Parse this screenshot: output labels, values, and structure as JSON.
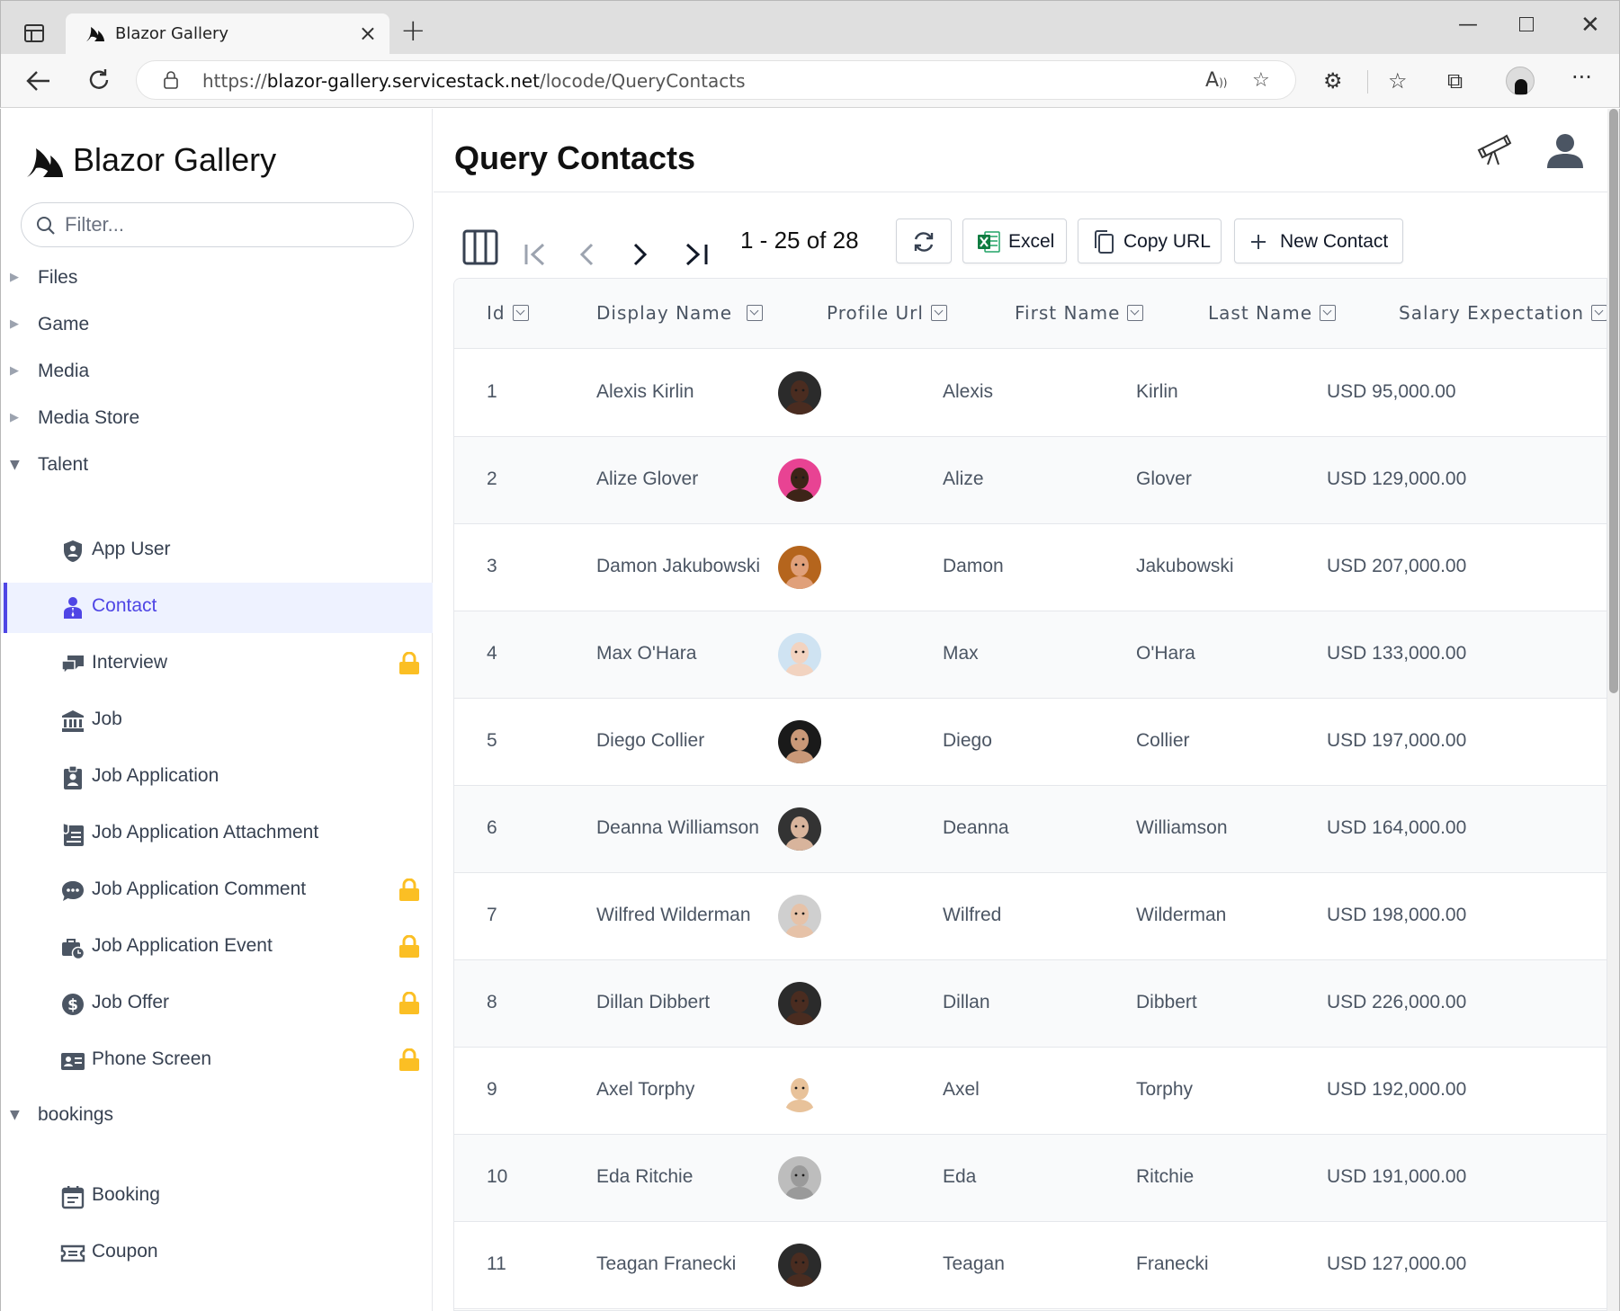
{
  "browser": {
    "tab_title": "Blazor Gallery",
    "url_prefix": "https://",
    "url_host": "blazor-gallery.servicestack.net",
    "url_path": "/locode/QueryContacts",
    "icons": [
      "tab-actions-icon",
      "close-icon",
      "plus-icon",
      "minimize-icon",
      "maximize-icon",
      "close-window-icon",
      "back-icon",
      "refresh-icon",
      "lock-icon",
      "read-aloud-icon",
      "add-favorite-icon",
      "extensions-icon",
      "favorites-icon",
      "collections-icon",
      "profile-icon",
      "more-icon"
    ]
  },
  "sidebar": {
    "brand": "Blazor Gallery",
    "filter_placeholder": "Filter...",
    "groups": [
      {
        "label": "Files",
        "open": false
      },
      {
        "label": "Game",
        "open": false
      },
      {
        "label": "Media",
        "open": false
      },
      {
        "label": "Media Store",
        "open": false
      },
      {
        "label": "Talent",
        "open": true
      },
      {
        "label": "bookings",
        "open": true
      }
    ],
    "talent_items": [
      {
        "label": "App User",
        "icon": "shield-user-icon",
        "locked": false
      },
      {
        "label": "Contact",
        "icon": "contact-icon",
        "locked": false,
        "active": true
      },
      {
        "label": "Interview",
        "icon": "chat-bubbles-icon",
        "locked": true
      },
      {
        "label": "Job",
        "icon": "bank-icon",
        "locked": false
      },
      {
        "label": "Job Application",
        "icon": "id-badge-icon",
        "locked": false
      },
      {
        "label": "Job Application Attachment",
        "icon": "attachment-list-icon",
        "locked": false
      },
      {
        "label": "Job Application Comment",
        "icon": "comment-icon",
        "locked": true
      },
      {
        "label": "Job Application Event",
        "icon": "briefcase-clock-icon",
        "locked": true
      },
      {
        "label": "Job Offer",
        "icon": "dollar-icon",
        "locked": true
      },
      {
        "label": "Phone Screen",
        "icon": "contact-card-icon",
        "locked": true
      }
    ],
    "bookings_items": [
      {
        "label": "Booking",
        "icon": "calendar-icon"
      },
      {
        "label": "Coupon",
        "icon": "ticket-icon"
      }
    ],
    "accent": "#4f46e5",
    "lock_color": "#fbbf24"
  },
  "main": {
    "title": "Query Contacts",
    "paging": "1 - 25 of 28",
    "buttons": {
      "excel": "Excel",
      "copy_url": "Copy URL",
      "new": "New Contact"
    },
    "columns": [
      "Id",
      "Display Name",
      "Profile Url",
      "First Name",
      "Last Name",
      "Salary Expectation"
    ],
    "rows": [
      {
        "id": "1",
        "display": "Alexis Kirlin",
        "first": "Alexis",
        "last": "Kirlin",
        "salary": "USD 95,000.00",
        "skin": "#4a2c20",
        "bg": "#2b2b2b"
      },
      {
        "id": "2",
        "display": "Alize Glover",
        "first": "Alize",
        "last": "Glover",
        "salary": "USD 129,000.00",
        "skin": "#3d2418",
        "bg": "#e84393"
      },
      {
        "id": "3",
        "display": "Damon Jakubowski",
        "first": "Damon",
        "last": "Jakubowski",
        "salary": "USD 207,000.00",
        "skin": "#e0a07a",
        "bg": "#b5651d"
      },
      {
        "id": "4",
        "display": "Max O'Hara",
        "first": "Max",
        "last": "O'Hara",
        "salary": "USD 133,000.00",
        "skin": "#f2d3c0",
        "bg": "#cfe3f2"
      },
      {
        "id": "5",
        "display": "Diego Collier",
        "first": "Diego",
        "last": "Collier",
        "salary": "USD 197,000.00",
        "skin": "#c99878",
        "bg": "#1a1a1a"
      },
      {
        "id": "6",
        "display": "Deanna Williamson",
        "first": "Deanna",
        "last": "Williamson",
        "salary": "USD 164,000.00",
        "skin": "#d8b49c",
        "bg": "#333333"
      },
      {
        "id": "7",
        "display": "Wilfred Wilderman",
        "first": "Wilfred",
        "last": "Wilderman",
        "salary": "USD 198,000.00",
        "skin": "#e6c2a8",
        "bg": "#cfcfcf"
      },
      {
        "id": "8",
        "display": "Dillan Dibbert",
        "first": "Dillan",
        "last": "Dibbert",
        "salary": "USD 226,000.00",
        "skin": "#4a2c20",
        "bg": "#2b2b2b"
      },
      {
        "id": "9",
        "display": "Axel Torphy",
        "first": "Axel",
        "last": "Torphy",
        "salary": "USD 192,000.00",
        "skin": "#e8c29a",
        "bg": "#ffffff"
      },
      {
        "id": "10",
        "display": "Eda Ritchie",
        "first": "Eda",
        "last": "Ritchie",
        "salary": "USD 191,000.00",
        "skin": "#9a9a9a",
        "bg": "#bdbdbd"
      },
      {
        "id": "11",
        "display": "Teagan Franecki",
        "first": "Teagan",
        "last": "Franecki",
        "salary": "USD 127,000.00",
        "skin": "#4a2c20",
        "bg": "#2b2b2b"
      }
    ]
  }
}
